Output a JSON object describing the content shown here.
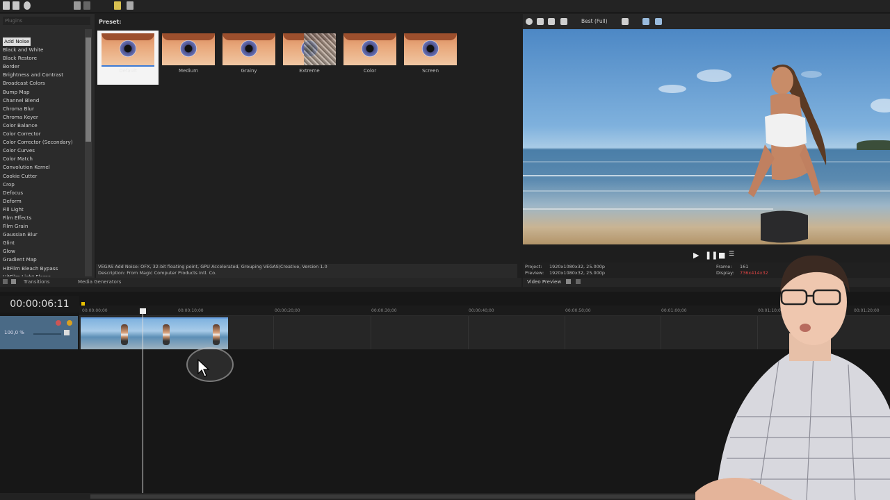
{
  "fx_list": {
    "search_placeholder": "Plugins",
    "items": [
      "Add Noise",
      "Black and White",
      "Black Restore",
      "Border",
      "Brightness and Contrast",
      "Broadcast Colors",
      "Bump Map",
      "Channel Blend",
      "Chroma Blur",
      "Chroma Keyer",
      "Color Balance",
      "Color Corrector",
      "Color Corrector (Secondary)",
      "Color Curves",
      "Color Match",
      "Convolution Kernel",
      "Cookie Cutter",
      "Crop",
      "Defocus",
      "Deform",
      "Fill Light",
      "Film Effects",
      "Film Grain",
      "Gaussian Blur",
      "Glint",
      "Glow",
      "Gradient Map",
      "HitFilm Bleach Bypass",
      "HitFilm Light Flares"
    ]
  },
  "preset_panel": {
    "title": "Preset:",
    "presets": [
      {
        "label": "Default",
        "selected": true
      },
      {
        "label": "Medium",
        "selected": false
      },
      {
        "label": "Grainy",
        "selected": false
      },
      {
        "label": "Extreme",
        "selected": false
      },
      {
        "label": "Color",
        "selected": false
      },
      {
        "label": "Screen",
        "selected": false
      }
    ],
    "description_line1": "VEGAS Add Noise: OFX, 32-bit floating point, GPU Accelerated, Grouping VEGAS\\Creative, Version 1.0",
    "description_line2": "Description: From Magic Computer Products Intl. Co."
  },
  "tabs": {
    "transitions": "Transitions",
    "media_generators": "Media Generators",
    "video_preview": "Video Preview"
  },
  "preview": {
    "quality": "Best (Full)",
    "project_label": "Project:",
    "project_value": "1920x1080x32, 25.000p",
    "preview_label": "Preview:",
    "preview_value": "1920x1080x32, 25.000p",
    "frame_label": "Frame:",
    "frame_value": "161",
    "display_label": "Display:",
    "display_value": "736x414x32"
  },
  "timeline": {
    "timecode": "00:00:06:11",
    "track_level": "100,0 %",
    "ruler_labels": [
      "00:00:00;00",
      "00:00:10;00",
      "00:00:20;00",
      "00:00:30;00",
      "00:00:40;00",
      "00:00:50;00",
      "00:01:00;00",
      "00:01:10;00",
      "00:01:20;00"
    ]
  },
  "colors": {
    "accent": "#3a7ad6",
    "track_header": "#4a6a86",
    "marker": "#e8c000"
  }
}
